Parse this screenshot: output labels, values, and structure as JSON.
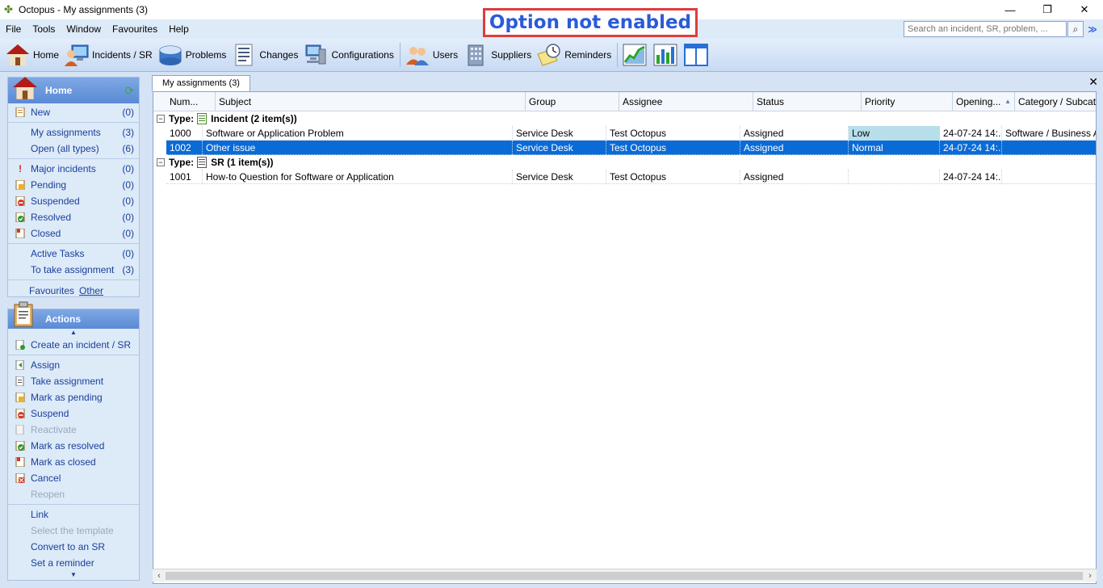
{
  "window": {
    "title": "Octopus - My assignments (3)",
    "minimize": "—",
    "restore": "❐",
    "close": "✕"
  },
  "notice": "Option not enabled",
  "menu": [
    "File",
    "Tools",
    "Window",
    "Favourites",
    "Help"
  ],
  "search": {
    "placeholder": "Search an incident, SR, problem, ...",
    "button": "⌕",
    "options": "≫"
  },
  "toolbar": [
    {
      "label": "Home",
      "icon": "house-icon"
    },
    {
      "label": "Incidents / SR",
      "icon": "computer-user-icon"
    },
    {
      "label": "Problems",
      "icon": "problem-box-icon"
    },
    {
      "label": "Changes",
      "icon": "document-list-icon"
    },
    {
      "label": "Configurations",
      "icon": "network-computer-icon"
    },
    {
      "label": "Users",
      "icon": "users-icon"
    },
    {
      "label": "Suppliers",
      "icon": "building-icon"
    },
    {
      "label": "Reminders",
      "icon": "clock-note-icon"
    },
    {
      "label": "",
      "icon": "line-chart-icon"
    },
    {
      "label": "",
      "icon": "bar-chart-icon"
    },
    {
      "label": "",
      "icon": "panel-layout-icon"
    }
  ],
  "home_panel": {
    "title": "Home",
    "items": [
      {
        "label": "New",
        "count": "(0)",
        "icon": "new-doc-icon"
      },
      {
        "label": "My assignments",
        "count": "(3)",
        "icon": ""
      },
      {
        "label": "Open (all types)",
        "count": "(6)",
        "icon": ""
      },
      {
        "label": "Major incidents",
        "count": "(0)",
        "icon": "exclamation-icon"
      },
      {
        "label": "Pending",
        "count": "(0)",
        "icon": "pending-icon"
      },
      {
        "label": "Suspended",
        "count": "(0)",
        "icon": "suspended-icon"
      },
      {
        "label": "Resolved",
        "count": "(0)",
        "icon": "resolved-icon"
      },
      {
        "label": "Closed",
        "count": "(0)",
        "icon": "closed-icon"
      },
      {
        "label": "Active Tasks",
        "count": "(0)",
        "icon": ""
      },
      {
        "label": "To take assignment",
        "count": "(3)",
        "icon": ""
      }
    ],
    "favourites": "Favourites",
    "other": "Other"
  },
  "actions_panel": {
    "title": "Actions",
    "items": [
      {
        "label": "Create an incident / SR",
        "enabled": true
      },
      {
        "label": "Assign",
        "enabled": true
      },
      {
        "label": "Take assignment",
        "enabled": true
      },
      {
        "label": "Mark as pending",
        "enabled": true
      },
      {
        "label": "Suspend",
        "enabled": true
      },
      {
        "label": "Reactivate",
        "enabled": false
      },
      {
        "label": "Mark as resolved",
        "enabled": true
      },
      {
        "label": "Mark as closed",
        "enabled": true
      },
      {
        "label": "Cancel",
        "enabled": true
      },
      {
        "label": "Reopen",
        "enabled": false
      },
      {
        "label": "Link",
        "enabled": true
      },
      {
        "label": "Select the template",
        "enabled": false
      },
      {
        "label": "Convert to an SR",
        "enabled": true
      },
      {
        "label": "Set a reminder",
        "enabled": true
      }
    ]
  },
  "tab": {
    "label": "My assignments (3)",
    "close": "✕"
  },
  "grid": {
    "columns": [
      "Num...",
      "Subject",
      "Group",
      "Assignee",
      "Status",
      "Priority",
      "Opening...",
      "Category / Subcategory"
    ],
    "groups": [
      {
        "label_prefix": "Type:",
        "label": "Incident (2 item(s))",
        "rows": [
          [
            "1000",
            "Software or Application Problem",
            "Service Desk",
            "Test Octopus",
            "Assigned",
            "Low",
            "24-07-24 14:...",
            "Software / Business Ap..."
          ],
          [
            "1002",
            "Other issue",
            "Service Desk",
            "Test Octopus",
            "Assigned",
            "Normal",
            "24-07-24 14:...",
            ""
          ]
        ]
      },
      {
        "label_prefix": "Type:",
        "label": "SR (1 item(s))",
        "rows": [
          [
            "1001",
            "How-to Question for Software or Application",
            "Service Desk",
            "Test Octopus",
            "Assigned",
            "",
            "24-07-24 14:...",
            ""
          ]
        ]
      }
    ],
    "toggle": "−"
  },
  "colors": {
    "selected": "#0a6bd6",
    "low_priority": "#b7dfea",
    "notice_border": "#e03c3c",
    "notice_text": "#2a5bd7"
  }
}
